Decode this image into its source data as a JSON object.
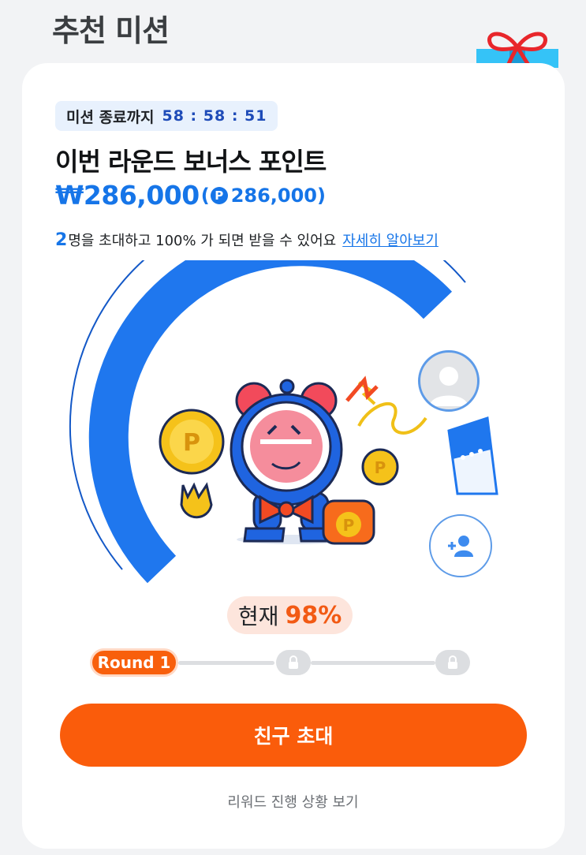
{
  "page": {
    "title": "추천 미션"
  },
  "mission": {
    "timer_label": "미션 종료까지",
    "timer_value": "58 : 58 : 51",
    "bonus_title": "이번 라운드 보너스 포인트",
    "amount_main": "₩286,000",
    "amount_paren_open": "(",
    "point_symbol": "P",
    "amount_points": "286,000)",
    "invite_count": "2",
    "invite_desc": "명을 초대하고 100% 가 되면 받을 수 있어요",
    "learn_more": "자세히 알아보기"
  },
  "progress": {
    "current_label": "현재",
    "current_value": "98%",
    "percent": 98
  },
  "rounds": {
    "active_label": "Round 1",
    "locked_count": 2
  },
  "actions": {
    "invite_button": "친구 초대",
    "reward_link": "리워드 진행 상황 보기"
  },
  "colors": {
    "accent_blue": "#1675e8",
    "accent_orange": "#fa5c0b",
    "gauge_blue": "#1f77ee"
  },
  "icons": [
    "gift-icon",
    "person-icon",
    "add-person-icon",
    "lock-icon",
    "point-coin-icon"
  ]
}
